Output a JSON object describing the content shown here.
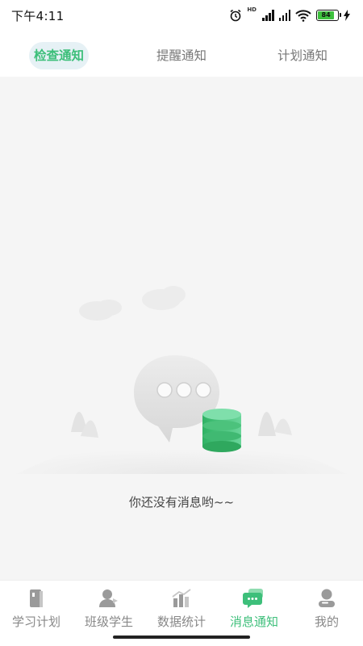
{
  "status_bar": {
    "time": "下午4:11",
    "battery": "84"
  },
  "top_tabs": [
    {
      "label": "检查通知",
      "active": true
    },
    {
      "label": "提醒通知",
      "active": false
    },
    {
      "label": "计划通知",
      "active": false
    }
  ],
  "empty_state": {
    "message": "你还没有消息哟~~"
  },
  "bottom_nav": [
    {
      "label": "学习计划",
      "icon": "book-icon",
      "active": false
    },
    {
      "label": "班级学生",
      "icon": "students-icon",
      "active": false
    },
    {
      "label": "数据统计",
      "icon": "chart-icon",
      "active": false
    },
    {
      "label": "消息通知",
      "icon": "message-icon",
      "active": true
    },
    {
      "label": "我的",
      "icon": "profile-icon",
      "active": false
    }
  ],
  "colors": {
    "accent": "#3dbf7a",
    "tab_active_bg": "#e6f1f5",
    "content_bg": "#f5f5f5"
  }
}
